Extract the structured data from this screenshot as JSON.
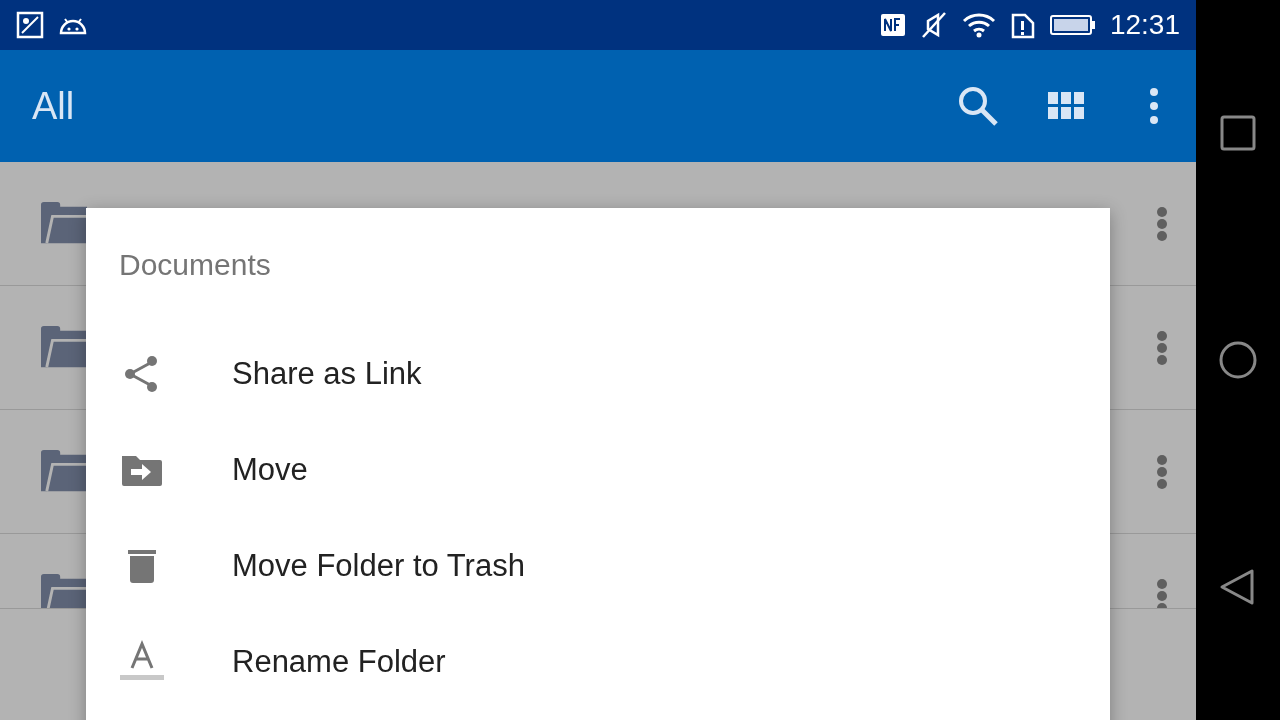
{
  "status_bar": {
    "time": "12:31"
  },
  "app_bar": {
    "title": "All"
  },
  "list": {
    "rows": [
      {
        "kind": "folder"
      },
      {
        "kind": "folder"
      },
      {
        "kind": "folder"
      },
      {
        "kind": "folder"
      }
    ]
  },
  "dialog": {
    "title": "Documents",
    "items": [
      {
        "kind": "share",
        "label": "Share as Link"
      },
      {
        "kind": "move",
        "label": "Move"
      },
      {
        "kind": "trash",
        "label": "Move Folder to Trash"
      },
      {
        "kind": "rename",
        "label": "Rename Folder"
      }
    ]
  }
}
